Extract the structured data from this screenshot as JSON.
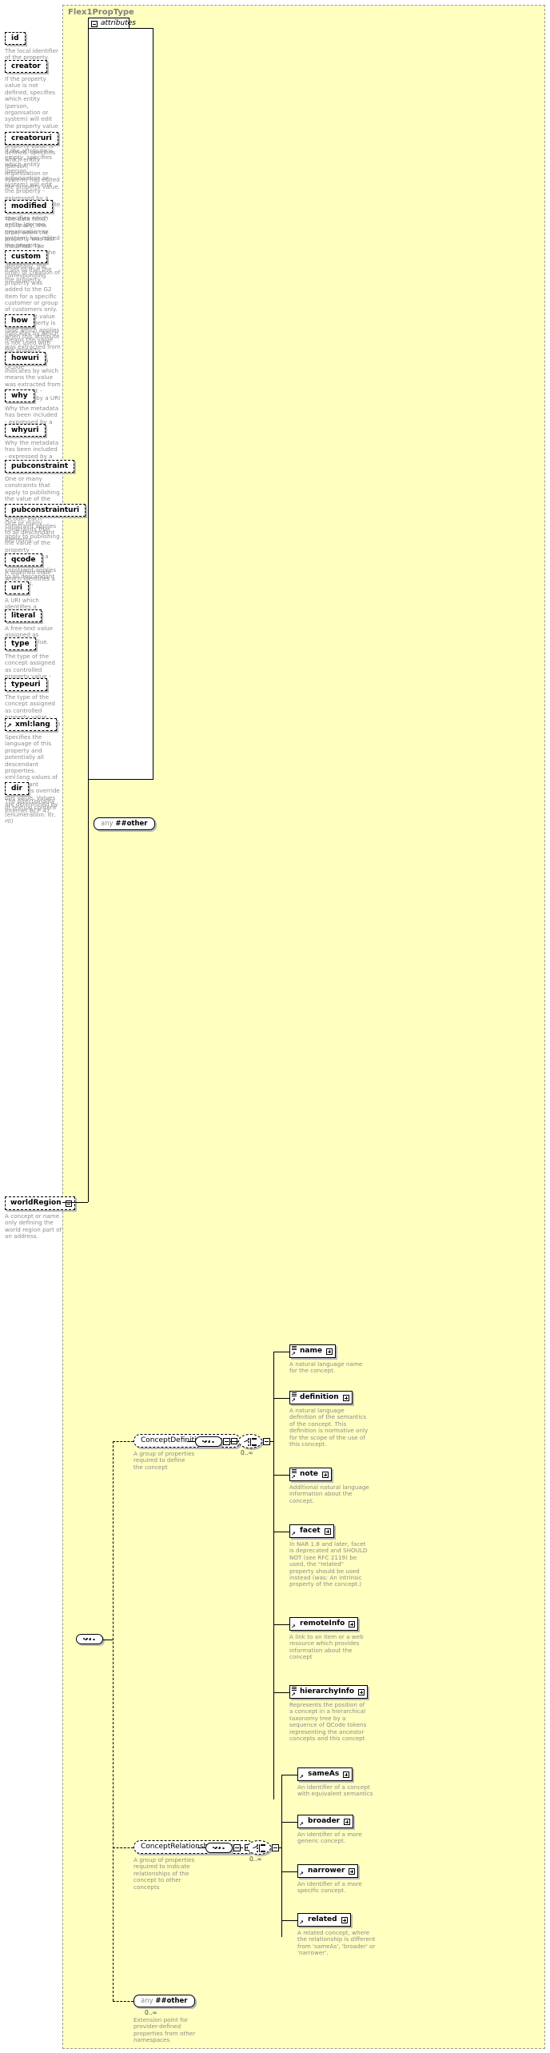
{
  "type": {
    "name": "Flex1PropType"
  },
  "attributes_panel": {
    "label": "attributes",
    "items": [
      {
        "name": "id",
        "desc": "The local identifier of the property."
      },
      {
        "name": "creator",
        "desc": "If the property value is not defined, specifies which entity (person, organisation or system) will edit the property value - expressed by a QCode. If the property value is defined, specifies which entity (person, organisation or system) has edited the property value."
      },
      {
        "name": "creatoruri",
        "desc": "If the attribute is empty, specifies which entity (person, organisation or system) will edit the property - expressed by a URI. If the attribute is non-empty, specifies which entity (person, organisation or system) has edited the property."
      },
      {
        "name": "modified",
        "desc": "The date (and, optionally, the time) when the property was last modified. The initial value is the date (and, optionally, the time) of creation of the property."
      },
      {
        "name": "custom",
        "desc": "If set to true the corresponding property was added to the G2 Item for a specific customer or group of customers only. The default value of this property is false which applies when this attribute is not used with the property."
      },
      {
        "name": "how",
        "desc": "Indicates by which means the value was extracted from the content - expressed by a QCode"
      },
      {
        "name": "howuri",
        "desc": "Indicates by which means the value was extracted from the content - expressed by a URI"
      },
      {
        "name": "why",
        "desc": "Why the metadata has been included - expressed by a QCode"
      },
      {
        "name": "whyuri",
        "desc": "Why the metadata has been included - expressed by a URI"
      },
      {
        "name": "pubconstraint",
        "desc": "One or many constraints that apply to publishing the value of the property - expressed by a QCode. Each constraint applies to all descendant elements."
      },
      {
        "name": "pubconstrainturi",
        "desc": "One or many constraints that apply to publishing the value of the property - expressed by a URI. Each constraint applies to all descendant elements."
      },
      {
        "name": "qcode",
        "desc": "A qualified code which identifies a concept."
      },
      {
        "name": "uri",
        "desc": "A URI which identifies a concept."
      },
      {
        "name": "literal",
        "desc": "A free-text value assigned as property value."
      },
      {
        "name": "type",
        "desc": "The type of the concept assigned as controlled property value - expressed by a QCode"
      },
      {
        "name": "typeuri",
        "desc": "The type of the concept assigned as controlled property value - expressed by a URI"
      },
      {
        "name": "xml:lang",
        "desc": "Specifies the language of this property and potentially all descendant properties. xml:lang values of descendant properties override this value. Values are determined by Internet BCP 47.",
        "inherited": true
      },
      {
        "name": "dir",
        "desc": "The directionality of textual content (enumeration: ltr, rtl)"
      }
    ],
    "any": {
      "prefix": "any",
      "label": "##other"
    }
  },
  "root_element": {
    "name": "worldRegion",
    "desc": "A concept or name only defining the world region part of an address."
  },
  "groups": [
    {
      "name": "ConceptDefinitionGroup",
      "desc": "A group of properties required to define the concept",
      "cardinality": "0..∞",
      "children": [
        {
          "name": "name",
          "desc": "A natural language name for the concept.",
          "toggle": "plus"
        },
        {
          "name": "definition",
          "desc": "A natural language definition of the semantics of the concept. This definition is normative only for the scope of the use of this concept.",
          "toggle": "plus"
        },
        {
          "name": "note",
          "desc": "Additional natural language information about the concept.",
          "toggle": "plus"
        },
        {
          "name": "facet",
          "desc": "In NAR 1.8 and later, facet is deprecated and SHOULD NOT (see RFC 2119) be used, the \"related\" property should be used instead (was: An intrinsic property of the concept.)",
          "toggle": "plus"
        },
        {
          "name": "remoteInfo",
          "desc": "A link to an item or a web resource which provides information about the concept",
          "toggle": "plus"
        },
        {
          "name": "hierarchyInfo",
          "desc": "Represents the position of a concept in a hierarchical taxonomy tree by a sequence of QCode tokens representing the ancestor concepts and this concept",
          "toggle": "plus"
        }
      ]
    },
    {
      "name": "ConceptRelationshipsGroup",
      "desc": "A group of properties required to indicate relationships of the concept to other concepts",
      "cardinality": "0..∞",
      "children": [
        {
          "name": "sameAs",
          "desc": "An identifier of a concept with equivalent semantics",
          "toggle": "plus"
        },
        {
          "name": "broader",
          "desc": "An identifier of a more generic concept.",
          "toggle": "plus"
        },
        {
          "name": "narrower",
          "desc": "An identifier of a more specific concept.",
          "toggle": "plus"
        },
        {
          "name": "related",
          "desc": "A related concept, where the relationship is different from 'sameAs', 'broader' or 'narrower'.",
          "toggle": "plus"
        }
      ]
    }
  ],
  "any_extension": {
    "prefix": "any",
    "label": "##other",
    "cardinality": "0..∞",
    "desc": "Extension point for provider-defined properties from other namespaces"
  },
  "colors": {
    "background": "#ffffc0",
    "desc_text": "#8c8c8c",
    "title_text": "#808080",
    "shadow": "#b9b9b9"
  }
}
